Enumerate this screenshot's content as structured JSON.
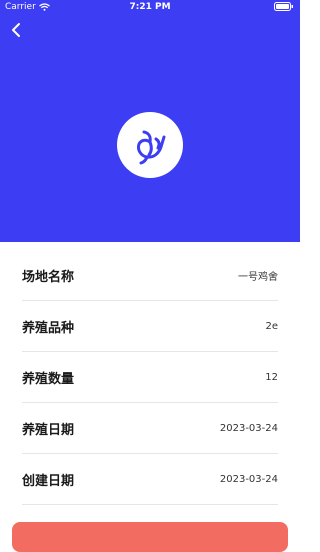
{
  "status_bar": {
    "carrier": "Carrier",
    "time": "7:21 PM"
  },
  "header": {
    "back_icon": "chevron-left-icon",
    "logo_icon": "bird-logo-icon",
    "color": "#3d3df4"
  },
  "details": [
    {
      "label": "场地名称",
      "value": "一号鸡舍"
    },
    {
      "label": "养殖品种",
      "value": "2e"
    },
    {
      "label": "养殖数量",
      "value": "12"
    },
    {
      "label": "养殖日期",
      "value": "2023-03-24"
    },
    {
      "label": "创建日期",
      "value": "2023-03-24"
    }
  ],
  "bottom_button": {
    "color": "#f26c61"
  }
}
